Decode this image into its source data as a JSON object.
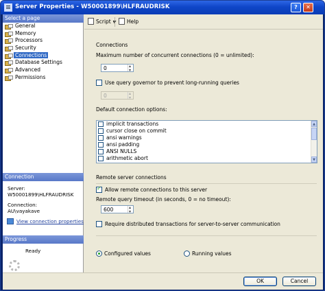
{
  "window": {
    "title": "Server Properties - W50001899\\HLFRAUDRISK",
    "help_glyph": "?",
    "close_glyph": "✕"
  },
  "left": {
    "select_page_header": "Select a page",
    "pages": [
      {
        "label": "General",
        "selected": false
      },
      {
        "label": "Memory",
        "selected": false
      },
      {
        "label": "Processors",
        "selected": false
      },
      {
        "label": "Security",
        "selected": false
      },
      {
        "label": "Connections",
        "selected": true
      },
      {
        "label": "Database Settings",
        "selected": false
      },
      {
        "label": "Advanced",
        "selected": false
      },
      {
        "label": "Permissions",
        "selected": false
      }
    ],
    "connection_header": "Connection",
    "server_label": "Server:",
    "server_value": "W50001899\\HLFRAUDRISK",
    "connection_label": "Connection:",
    "connection_value": "AU\\vayakave",
    "view_connection_link": "View connection properties",
    "progress_header": "Progress",
    "progress_status": "Ready"
  },
  "toolbar": {
    "script_label": "Script",
    "help_label": "Help"
  },
  "connections": {
    "section_label": "Connections",
    "max_connections_label": "Maximum number of concurrent connections (0 = unlimited):",
    "max_connections_value": "0",
    "query_governor_label": "Use query governor to prevent long-running queries",
    "query_governor_checked": false,
    "query_governor_value": "0",
    "default_options_label": "Default connection options:",
    "options": [
      {
        "label": "implicit transactions",
        "checked": false
      },
      {
        "label": "cursor close on commit",
        "checked": false
      },
      {
        "label": "ansi warnings",
        "checked": false
      },
      {
        "label": "ansi padding",
        "checked": false
      },
      {
        "label": "ANSI NULLS",
        "checked": false
      },
      {
        "label": "arithmetic abort",
        "checked": false
      }
    ]
  },
  "remote": {
    "section_label": "Remote server connections",
    "allow_remote_label": "Allow remote connections to this server",
    "allow_remote_checked": true,
    "timeout_label": "Remote query timeout (in seconds, 0 = no timeout):",
    "timeout_value": "600",
    "distributed_label": "Require distributed transactions for server-to-server communication",
    "distributed_checked": false
  },
  "values_mode": {
    "configured_label": "Configured values",
    "running_label": "Running values",
    "selected": "configured"
  },
  "buttons": {
    "ok_label": "OK",
    "cancel_label": "Cancel"
  }
}
